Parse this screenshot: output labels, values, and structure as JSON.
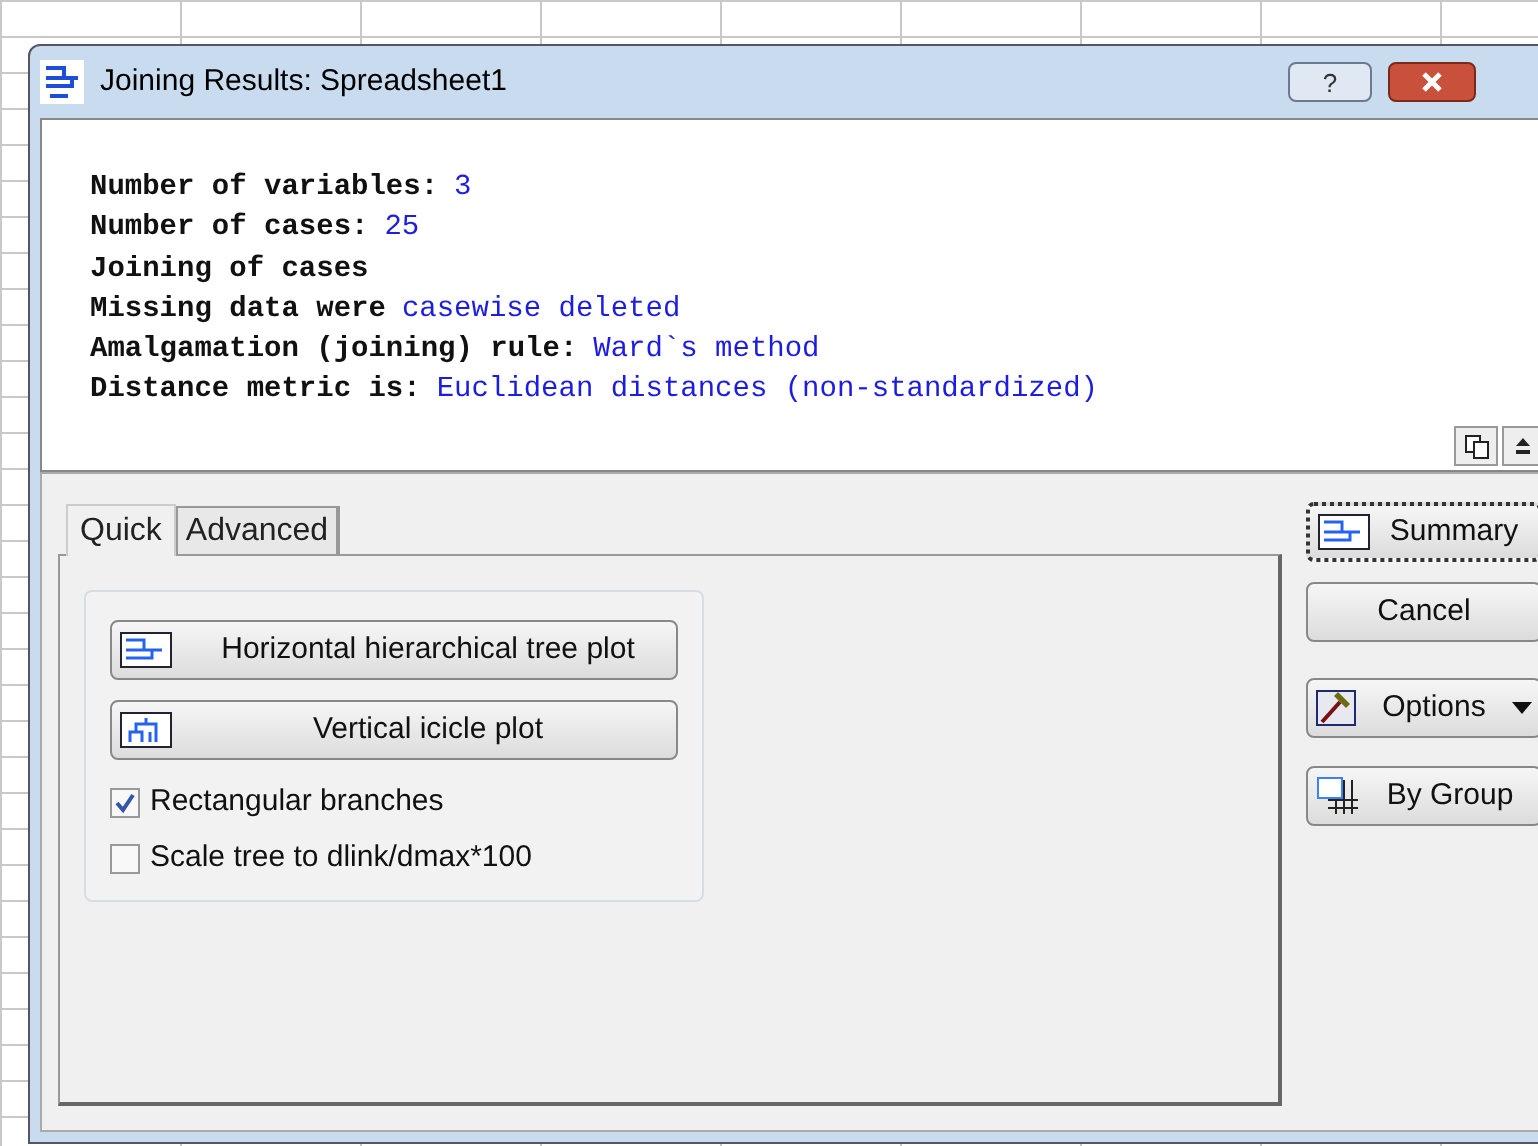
{
  "window": {
    "title": "Joining Results: Spreadsheet1",
    "help_button": "?"
  },
  "output": {
    "lines": [
      {
        "label": "Number of variables:",
        "value": "3"
      },
      {
        "label": "Number of cases:",
        "value": "25"
      },
      {
        "label": "Joining of cases"
      },
      {
        "label": "Missing data were",
        "value": "casewise deleted"
      },
      {
        "label": "Amalgamation (joining) rule:",
        "value": "Ward`s method"
      },
      {
        "label": "Distance metric is:",
        "value": "Euclidean distances (non-standardized)"
      }
    ]
  },
  "tabs": [
    {
      "label": "Quick",
      "selected": true
    },
    {
      "label": "Advanced",
      "selected": false
    }
  ],
  "plot_buttons": [
    {
      "label": "Horizontal hierarchical tree plot",
      "kind": "horizontal"
    },
    {
      "label": "Vertical icicle plot",
      "kind": "vertical"
    }
  ],
  "checkboxes": [
    {
      "label": "Rectangular branches",
      "checked": true
    },
    {
      "label": "Scale tree to dlink/dmax*100",
      "checked": false
    }
  ],
  "side_buttons": [
    {
      "label": "Summary",
      "kind": "summary",
      "selected": true
    },
    {
      "label": "Cancel",
      "kind": "plain",
      "selected": false
    },
    {
      "label": "Options",
      "kind": "options",
      "selected": false
    },
    {
      "label": "By Group",
      "kind": "bygroup",
      "selected": false
    }
  ]
}
